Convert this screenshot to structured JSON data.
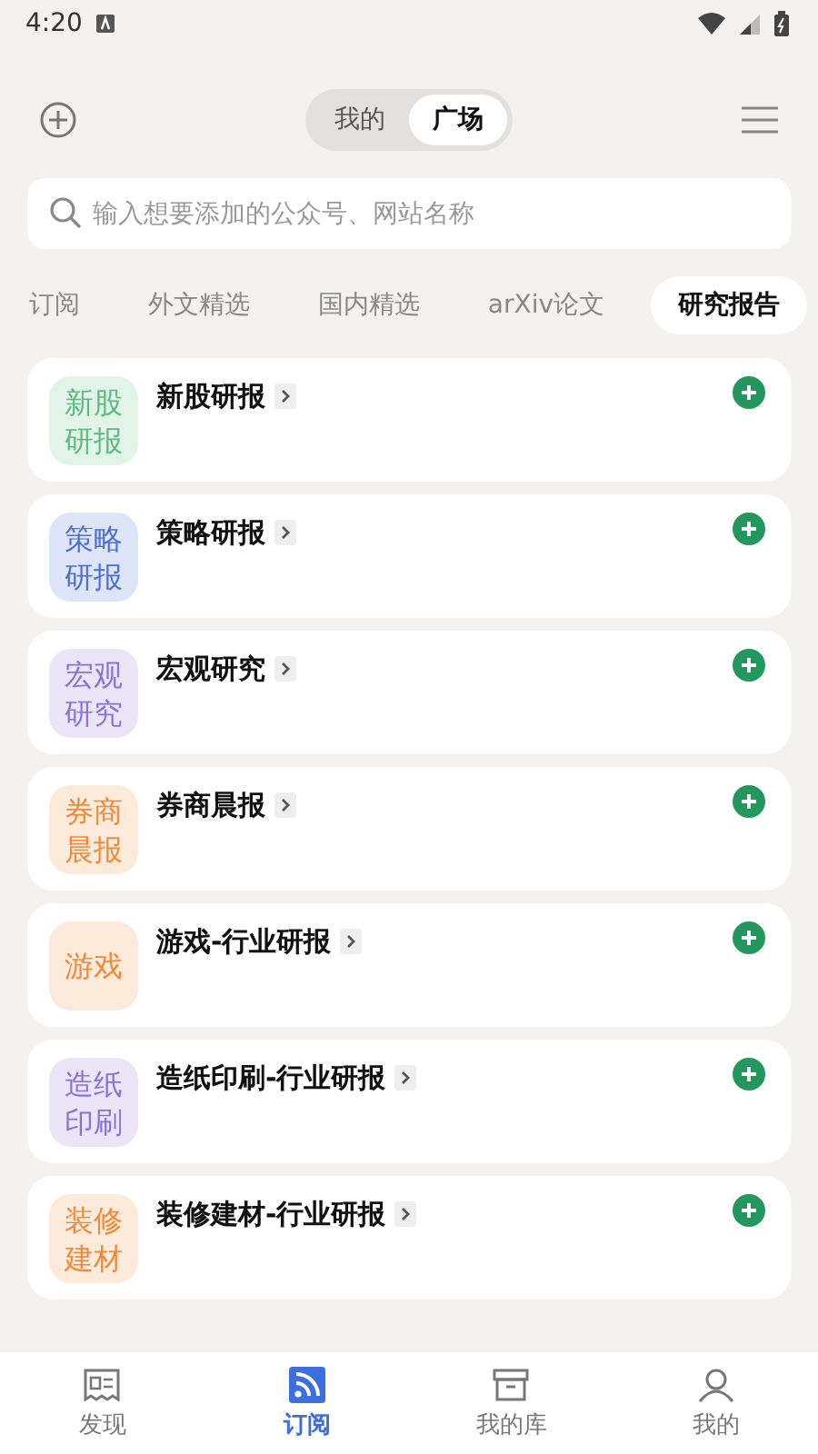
{
  "status_bar": {
    "time": "4:20"
  },
  "header": {
    "segments": [
      {
        "label": "我的",
        "selected": false
      },
      {
        "label": "广场",
        "selected": true
      }
    ]
  },
  "search": {
    "placeholder": "输入想要添加的公众号、网站名称"
  },
  "categories": [
    {
      "label": "订阅",
      "selected": false
    },
    {
      "label": "外文精选",
      "selected": false
    },
    {
      "label": "国内精选",
      "selected": false
    },
    {
      "label": "arXiv论文",
      "selected": false
    },
    {
      "label": "研究报告",
      "selected": true
    }
  ],
  "feeds": [
    {
      "badge": "新股研报",
      "color": "#5dbb80",
      "title": "新股研报"
    },
    {
      "badge": "策略研报",
      "color": "#4a6fd6",
      "title": "策略研报"
    },
    {
      "badge": "宏观研究",
      "color": "#8a72d8",
      "title": "宏观研究"
    },
    {
      "badge": "券商晨报",
      "color": "#ee8a3a",
      "title": "券商晨报"
    },
    {
      "badge": "游戏",
      "color": "#ee8a3a",
      "title": "游戏-行业研报"
    },
    {
      "badge": "造纸印刷",
      "color": "#8a72d8",
      "title": "造纸印刷-行业研报"
    },
    {
      "badge": "装修建材",
      "color": "#ee8a3a",
      "title": "装修建材-行业研报"
    }
  ],
  "bottom_nav": [
    {
      "label": "发现",
      "selected": false,
      "kind": "discover"
    },
    {
      "label": "订阅",
      "selected": true,
      "kind": "rss"
    },
    {
      "label": "我的库",
      "selected": false,
      "kind": "box"
    },
    {
      "label": "我的",
      "selected": false,
      "kind": "person"
    }
  ]
}
